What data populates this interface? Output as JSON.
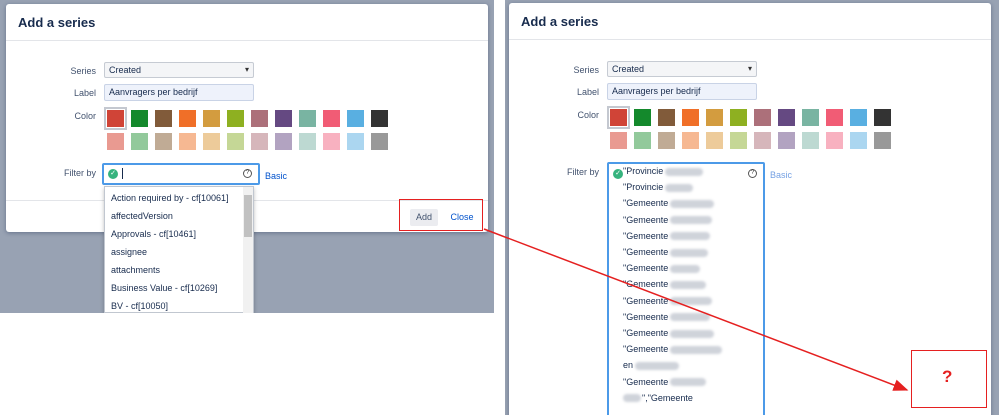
{
  "left": {
    "dialog_title": "Add a series",
    "series": {
      "label": "Series",
      "value": "Created"
    },
    "label_field": {
      "label": "Label",
      "value": "Aanvragers per bedrijf"
    },
    "color_label": "Color",
    "filter": {
      "label": "Filter by",
      "basic_link": "Basic"
    },
    "dropdown_items": [
      "Action required by - cf[10061]",
      "affectedVersion",
      "Approvals - cf[10461]",
      "assignee",
      "attachments",
      "Business Value - cf[10269]",
      "BV - cf[10050]"
    ],
    "add_button": "Add",
    "close_button": "Close"
  },
  "right": {
    "dialog_title": "Add a series",
    "series": {
      "label": "Series",
      "value": "Created"
    },
    "label_field": {
      "label": "Label",
      "value": "Aanvragers per bedrijf"
    },
    "color_label": "Color",
    "filter": {
      "label": "Filter by",
      "basic_link": "Basic"
    },
    "query_lines": [
      "\"Provincie",
      "\"Provincie",
      "\"Gemeente",
      "\"Gemeente",
      "\"Gemeente",
      "\"Gemeente",
      "\"Gemeente",
      "\"Gemeente",
      "\"Gemeente",
      "\"Gemeente",
      "\"Gemeente",
      "\"Gemeente",
      "en",
      "\"Gemeente",
      "\",\"Gemeente"
    ]
  },
  "swatches": {
    "row1": [
      "#d04437",
      "#14892c",
      "#815b3a",
      "#f06f28",
      "#d39c3f",
      "#8eb021",
      "#ac707a",
      "#654982",
      "#79b4a2",
      "#f15c75",
      "#59afe1",
      "#333333"
    ],
    "row2": [
      "#e99a91",
      "#92c99b",
      "#c0ab95",
      "#f6b892",
      "#edcb9a",
      "#c5d796",
      "#d6b6bb",
      "#b2a3c1",
      "#bdd9d2",
      "#f8b1c0",
      "#abd6f0",
      "#999999"
    ]
  },
  "annotation": {
    "mark": "?"
  },
  "colors": {
    "highlight": "#e52020",
    "focus": "#4c9ae8",
    "link": "#0052cc"
  }
}
